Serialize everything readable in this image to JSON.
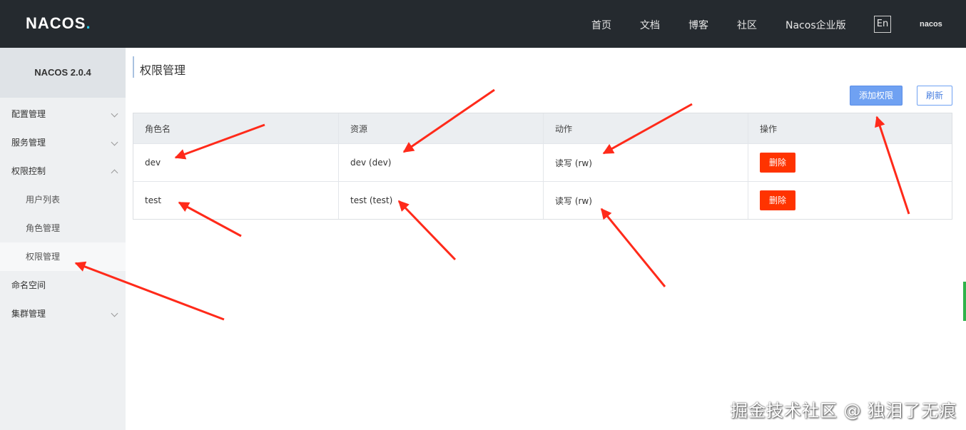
{
  "topbar": {
    "logo": "NACOS",
    "logo_dot": ".",
    "nav": [
      "首页",
      "文档",
      "博客",
      "社区",
      "Nacos企业版"
    ],
    "lang_button": "En",
    "user": "nacos"
  },
  "sidebar": {
    "version": "NACOS 2.0.4",
    "items": [
      {
        "label": "配置管理",
        "expandable": true
      },
      {
        "label": "服务管理",
        "expandable": true
      },
      {
        "label": "权限控制",
        "expandable": true,
        "expanded": true
      },
      {
        "label": "用户列表",
        "sub": true
      },
      {
        "label": "角色管理",
        "sub": true
      },
      {
        "label": "权限管理",
        "sub": true,
        "active": true
      },
      {
        "label": "命名空间"
      },
      {
        "label": "集群管理",
        "expandable": true
      }
    ]
  },
  "main": {
    "title": "权限管理",
    "add_button": "添加权限",
    "refresh_button": "刷新",
    "table": {
      "columns": [
        "角色名",
        "资源",
        "动作",
        "操作"
      ],
      "rows": [
        {
          "role": "dev",
          "resource": "dev (dev)",
          "action": "读写 (rw)",
          "op": "删除"
        },
        {
          "role": "test",
          "resource": "test (test)",
          "action": "读写 (rw)",
          "op": "删除"
        }
      ]
    }
  },
  "watermark": "掘金技术社区 @ 独泪了无痕",
  "colors": {
    "topbar_bg": "#252a2f",
    "primary_button": "#6fa1f2",
    "delete_button": "#ff3300",
    "annotation_arrow": "#ff2a1a"
  }
}
